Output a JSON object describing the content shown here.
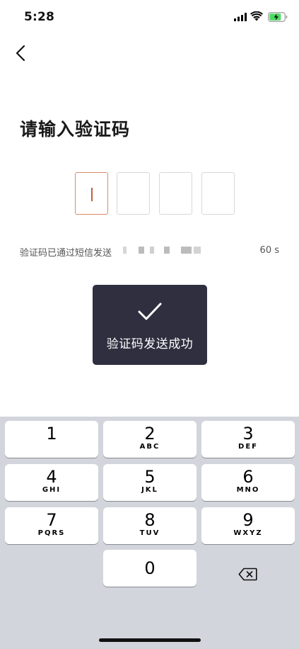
{
  "status_bar": {
    "time": "5:28",
    "signal_icon": "cellular-signal-icon",
    "wifi_icon": "wifi-icon",
    "battery_icon": "battery-charging-icon",
    "battery_color": "#4cd964"
  },
  "nav": {
    "back_icon": "chevron-left-icon"
  },
  "title": "请输入验证码",
  "code_input": {
    "digits": [
      "",
      "",
      "",
      ""
    ],
    "active_index": 0,
    "active_border_color": "#d98a6a"
  },
  "hint": {
    "text": "验证码已通过短信发送",
    "countdown": "60 s"
  },
  "toast": {
    "icon": "checkmark-icon",
    "message": "验证码发送成功",
    "background": "#2f2f40"
  },
  "keypad": {
    "keys": [
      {
        "digit": "1",
        "letters": ""
      },
      {
        "digit": "2",
        "letters": "ABC"
      },
      {
        "digit": "3",
        "letters": "DEF"
      },
      {
        "digit": "4",
        "letters": "GHI"
      },
      {
        "digit": "5",
        "letters": "JKL"
      },
      {
        "digit": "6",
        "letters": "MNO"
      },
      {
        "digit": "7",
        "letters": "PQRS"
      },
      {
        "digit": "8",
        "letters": "TUV"
      },
      {
        "digit": "9",
        "letters": "WXYZ"
      },
      {
        "digit": "0",
        "letters": ""
      }
    ],
    "delete_icon": "backspace-icon",
    "background": "#d2d5db"
  }
}
